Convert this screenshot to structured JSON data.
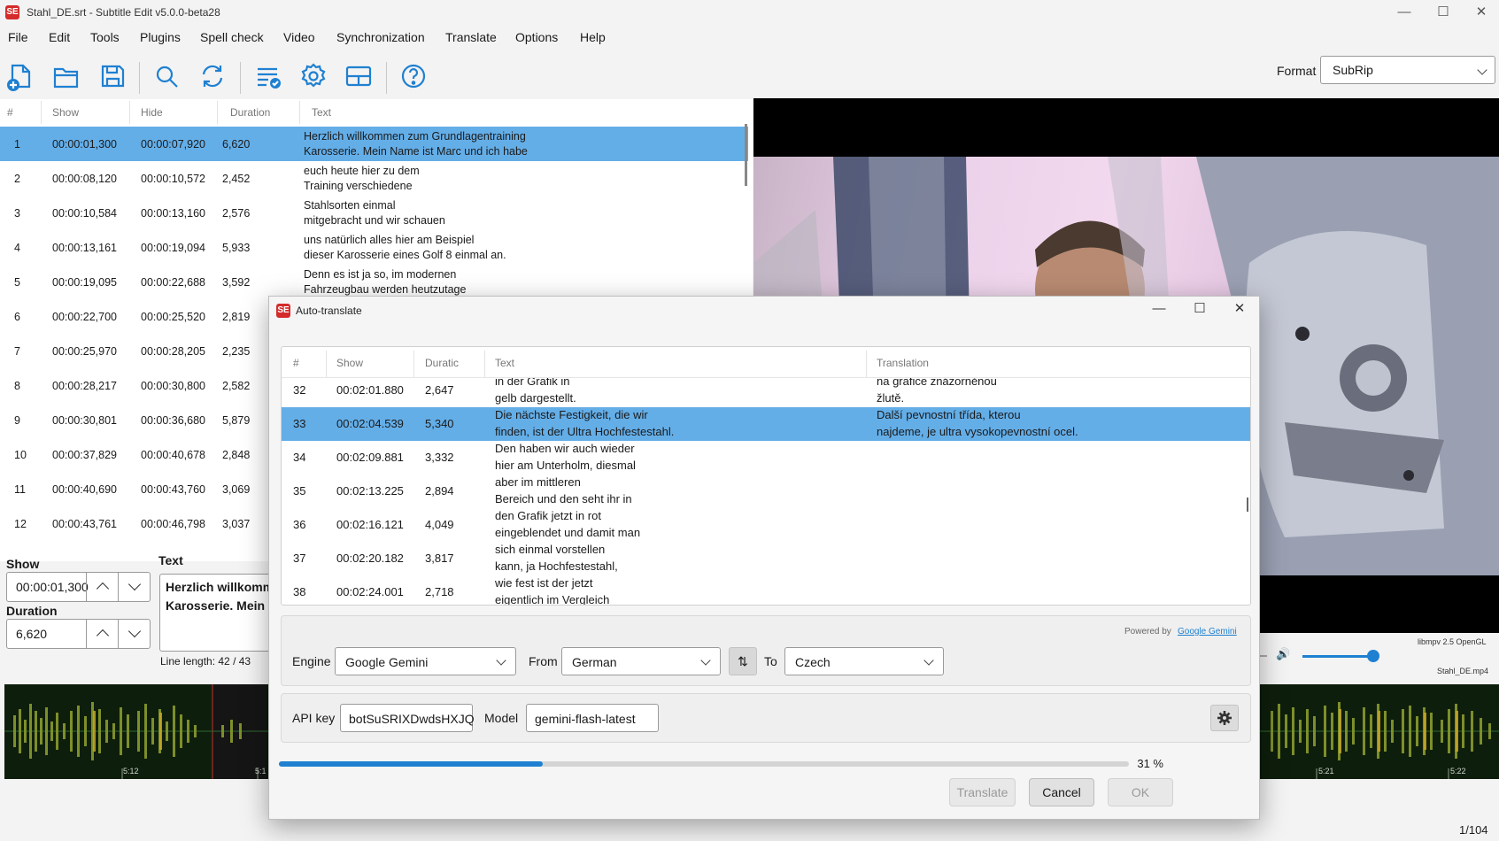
{
  "window": {
    "title": "Stahl_DE.srt - Subtitle Edit v5.0.0-beta28",
    "icon_text": "SE",
    "minimize": "—",
    "maximize": "☐",
    "close": "✕"
  },
  "menu": [
    "File",
    "Edit",
    "Tools",
    "Plugins",
    "Spell check",
    "Video",
    "Synchronization",
    "Translate",
    "Options",
    "Help"
  ],
  "toolbar": {
    "icons": [
      "new-file-icon",
      "open-folder-icon",
      "save-icon",
      "search-icon",
      "replace-icon",
      "fix-errors-icon",
      "settings-icon",
      "layout-icon",
      "help-icon"
    ],
    "format_label": "Format",
    "format_value": "SubRip",
    "accent": "#1f80d1"
  },
  "grid": {
    "columns": [
      "#",
      "Show",
      "Hide",
      "Duration",
      "Text"
    ],
    "rows": [
      {
        "n": "1",
        "show": "00:00:01,300",
        "hide": "00:00:07,920",
        "dur": "6,620",
        "l1": "Herzlich willkommen zum Grundlagentraining",
        "l2": "Karosserie. Mein Name ist Marc und ich habe"
      },
      {
        "n": "2",
        "show": "00:00:08,120",
        "hide": "00:00:10,572",
        "dur": "2,452",
        "l1": "euch heute hier zu dem",
        "l2": "Training verschiedene"
      },
      {
        "n": "3",
        "show": "00:00:10,584",
        "hide": "00:00:13,160",
        "dur": "2,576",
        "l1": "Stahlsorten einmal",
        "l2": "mitgebracht und wir schauen"
      },
      {
        "n": "4",
        "show": "00:00:13,161",
        "hide": "00:00:19,094",
        "dur": "5,933",
        "l1": "uns natürlich alles hier am Beispiel",
        "l2": "dieser Karosserie eines Golf 8 einmal an."
      },
      {
        "n": "5",
        "show": "00:00:19,095",
        "hide": "00:00:22,688",
        "dur": "3,592",
        "l1": "Denn es ist ja so, im modernen",
        "l2": "Fahrzeugbau werden heutzutage"
      },
      {
        "n": "6",
        "show": "00:00:22,700",
        "hide": "00:00:25,520",
        "dur": "2,819",
        "l1": "",
        "l2": ""
      },
      {
        "n": "7",
        "show": "00:00:25,970",
        "hide": "00:00:28,205",
        "dur": "2,235",
        "l1": "",
        "l2": ""
      },
      {
        "n": "8",
        "show": "00:00:28,217",
        "hide": "00:00:30,800",
        "dur": "2,582",
        "l1": "",
        "l2": ""
      },
      {
        "n": "9",
        "show": "00:00:30,801",
        "hide": "00:00:36,680",
        "dur": "5,879",
        "l1": "",
        "l2": ""
      },
      {
        "n": "10",
        "show": "00:00:37,829",
        "hide": "00:00:40,678",
        "dur": "2,848",
        "l1": "",
        "l2": ""
      },
      {
        "n": "11",
        "show": "00:00:40,690",
        "hide": "00:00:43,760",
        "dur": "3,069",
        "l1": "",
        "l2": ""
      },
      {
        "n": "12",
        "show": "00:00:43,761",
        "hide": "00:00:46,798",
        "dur": "3,037",
        "l1": "",
        "l2": ""
      }
    ]
  },
  "edit": {
    "show_label": "Show",
    "show_value": "00:00:01,300",
    "duration_label": "Duration",
    "duration_value": "6,620",
    "text_label": "Text",
    "text_line1": "Herzlich willkommen zum Grundlagentraining",
    "text_line2": "Karosserie. Mein Name ist Marc und ich habe",
    "line_length": "Line length:  42 / 43"
  },
  "video": {
    "renderer": "libmpv 2.5 OpenGL",
    "file": "Stahl_DE.mp4"
  },
  "waveform": {
    "ticks": [
      "5:12",
      "5:1",
      "5:21",
      "5:22"
    ]
  },
  "status": {
    "position": "1/104"
  },
  "dialog": {
    "title": "Auto-translate",
    "icon_text": "SE",
    "columns": [
      "#",
      "Show",
      "Duratic",
      "Text",
      "Translation"
    ],
    "rows": [
      {
        "n": "32",
        "show": "00:02:01.880",
        "dur": "2,647",
        "t1": "in der Grafik in",
        "t2": "gelb dargestellt.",
        "r1": "na grafice znázorněnou",
        "r2": "žlutě."
      },
      {
        "n": "33",
        "show": "00:02:04.539",
        "dur": "5,340",
        "t1": "Die nächste Festigkeit, die wir",
        "t2": "finden, ist der Ultra Hochfestestahl.",
        "r1": "Další pevnostní třída, kterou",
        "r2": "najdeme, je ultra vysokopevnostní ocel."
      },
      {
        "n": "34",
        "show": "00:02:09.881",
        "dur": "3,332",
        "t1": "Den haben wir auch wieder",
        "t2": "hier am Unterholm, diesmal",
        "r1": "",
        "r2": ""
      },
      {
        "n": "35",
        "show": "00:02:13.225",
        "dur": "2,894",
        "t1": "aber im mittleren",
        "t2": "Bereich und den seht ihr in",
        "r1": "",
        "r2": ""
      },
      {
        "n": "36",
        "show": "00:02:16.121",
        "dur": "4,049",
        "t1": "den Grafik jetzt in rot",
        "t2": "eingeblendet und damit man",
        "r1": "",
        "r2": ""
      },
      {
        "n": "37",
        "show": "00:02:20.182",
        "dur": "3,817",
        "t1": "sich einmal vorstellen",
        "t2": "kann, ja Hochfestestahl,",
        "r1": "",
        "r2": ""
      },
      {
        "n": "38",
        "show": "00:02:24.001",
        "dur": "2,718",
        "t1": "wie fest ist der jetzt",
        "t2": "eigentlich im Vergleich",
        "r1": "",
        "r2": ""
      }
    ],
    "powered_by": "Powered by",
    "powered_link": "Google Gemini",
    "engine_label": "Engine",
    "engine_value": "Google Gemini",
    "from_label": "From",
    "from_value": "German",
    "swap_icon": "⇅",
    "to_label": "To",
    "to_value": "Czech",
    "api_key_label": "API key",
    "api_key_value": "botSuSRIXDwdsHXJQ",
    "model_label": "Model",
    "model_value": "gemini-flash-latest",
    "progress_fraction": 0.31,
    "progress_text": "31 %",
    "translate_label": "Translate",
    "cancel_label": "Cancel",
    "ok_label": "OK"
  }
}
